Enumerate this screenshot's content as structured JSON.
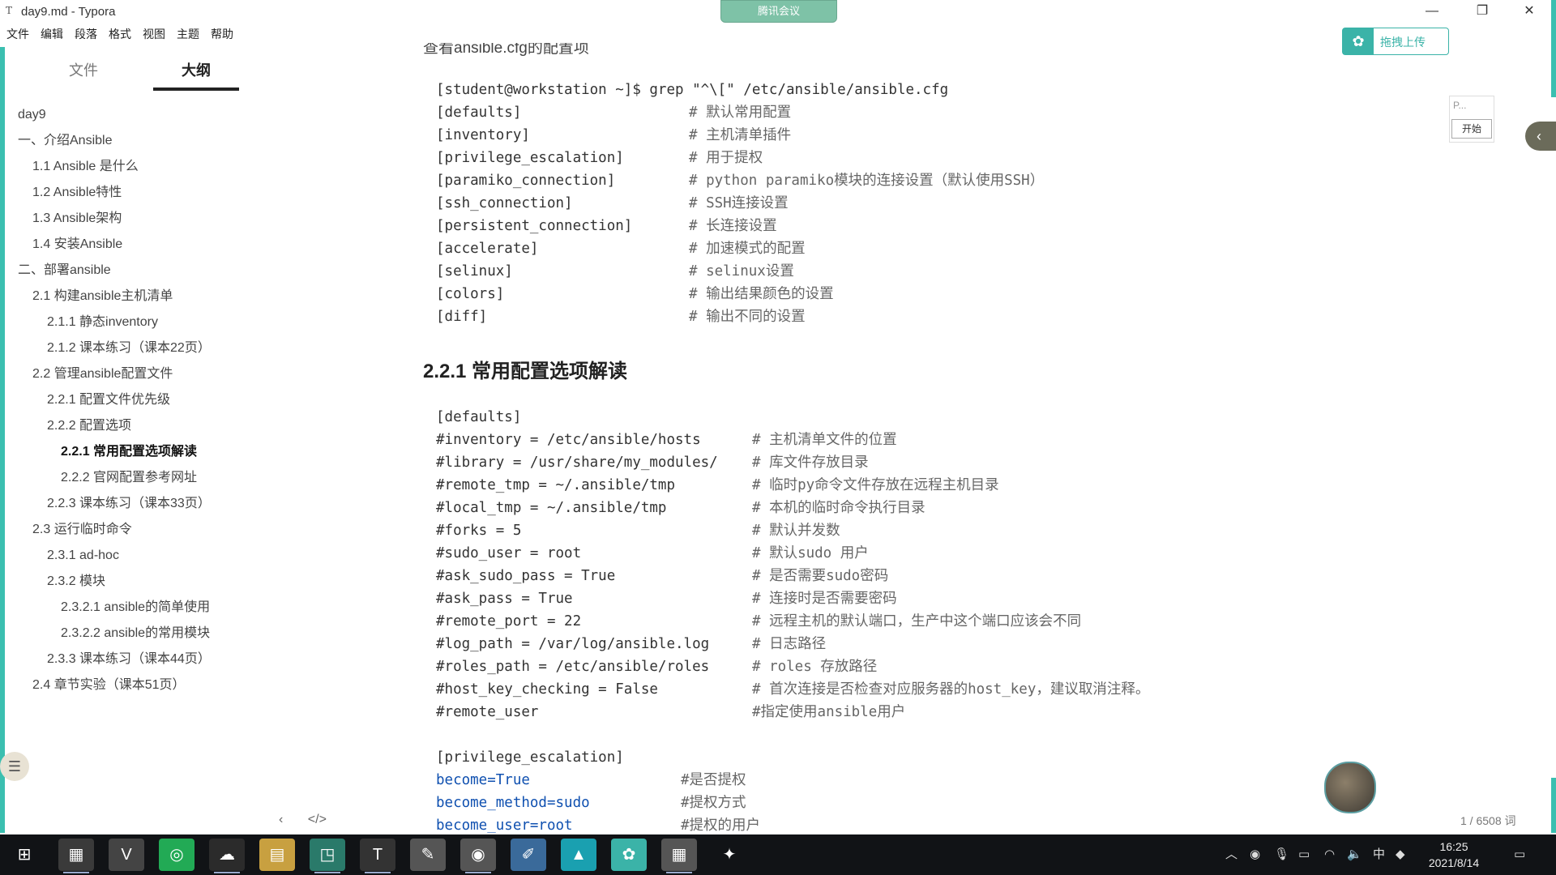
{
  "window": {
    "title": "day9.md - Typora",
    "minimize": "—",
    "maximize": "❐",
    "close": "✕"
  },
  "meeting": {
    "label": "腾讯会议"
  },
  "menu": [
    "文件",
    "编辑",
    "段落",
    "格式",
    "视图",
    "主题",
    "帮助"
  ],
  "sidebar": {
    "tabs": [
      {
        "label": "文件",
        "active": false
      },
      {
        "label": "大纲",
        "active": true
      }
    ],
    "outline": [
      {
        "label": "day9",
        "level": 0
      },
      {
        "label": "一、介绍Ansible",
        "level": 0
      },
      {
        "label": "1.1 Ansible 是什么",
        "level": 1
      },
      {
        "label": "1.2 Ansible特性",
        "level": 1
      },
      {
        "label": "1.3 Ansible架构",
        "level": 1
      },
      {
        "label": "1.4 安装Ansible",
        "level": 1
      },
      {
        "label": "二、部署ansible",
        "level": 0
      },
      {
        "label": "2.1 构建ansible主机清单",
        "level": 1
      },
      {
        "label": "2.1.1 静态inventory",
        "level": 2
      },
      {
        "label": "2.1.2 课本练习（课本22页）",
        "level": 2
      },
      {
        "label": "2.2 管理ansible配置文件",
        "level": 1
      },
      {
        "label": "2.2.1 配置文件优先级",
        "level": 2
      },
      {
        "label": "2.2.2 配置选项",
        "level": 2
      },
      {
        "label": "2.2.1 常用配置选项解读",
        "level": 3,
        "active": true
      },
      {
        "label": "2.2.2 官网配置参考网址",
        "level": 3
      },
      {
        "label": "2.2.3 课本练习（课本33页）",
        "level": 2
      },
      {
        "label": "2.3 运行临时命令",
        "level": 1
      },
      {
        "label": "2.3.1 ad-hoc",
        "level": 2
      },
      {
        "label": "2.3.2 模块",
        "level": 2
      },
      {
        "label": "2.3.2.1 ansible的简单使用",
        "level": 3
      },
      {
        "label": "2.3.2.2 ansible的常用模块",
        "level": 3
      },
      {
        "label": "2.3.3 课本练习（课本44页）",
        "level": 2
      },
      {
        "label": "2.4 章节实验（课本51页）",
        "level": 1
      }
    ],
    "bottom": {
      "back": "‹",
      "source": "</>"
    }
  },
  "editor": {
    "cut_heading": "查看ansible.cfg的配置项",
    "block1": [
      {
        "a": "[student@workstation ~]$ grep \"^\\[\" /etc/ansible/ansible.cfg",
        "b": ""
      },
      {
        "a": "[defaults]",
        "b": "# 默认常用配置"
      },
      {
        "a": "[inventory]",
        "b": "# 主机清单插件"
      },
      {
        "a": "[privilege_escalation]",
        "b": "# 用于提权"
      },
      {
        "a": "[paramiko_connection]",
        "b": "# python paramiko模块的连接设置（默认使用SSH）"
      },
      {
        "a": "[ssh_connection]",
        "b": "# SSH连接设置"
      },
      {
        "a": "[persistent_connection]",
        "b": "# 长连接设置"
      },
      {
        "a": "[accelerate]",
        "b": "# 加速模式的配置"
      },
      {
        "a": "[selinux]",
        "b": "# selinux设置"
      },
      {
        "a": "[colors]",
        "b": "# 输出结果颜色的设置"
      },
      {
        "a": "[diff]",
        "b": "# 输出不同的设置"
      }
    ],
    "heading": "2.2.1 常用配置选项解读",
    "block2": [
      {
        "a": "[defaults]",
        "b": ""
      },
      {
        "a": "#inventory = /etc/ansible/hosts",
        "b": "# 主机清单文件的位置"
      },
      {
        "a": "#library = /usr/share/my_modules/",
        "b": "# 库文件存放目录"
      },
      {
        "a": "#remote_tmp = ~/.ansible/tmp",
        "b": "# 临时py命令文件存放在远程主机目录"
      },
      {
        "a": "#local_tmp = ~/.ansible/tmp",
        "b": "# 本机的临时命令执行目录"
      },
      {
        "a": "#forks = 5",
        "b": "# 默认并发数"
      },
      {
        "a": "#sudo_user = root",
        "b": "# 默认sudo 用户"
      },
      {
        "a": "#ask_sudo_pass = True",
        "b": "# 是否需要sudo密码"
      },
      {
        "a": "#ask_pass = True",
        "b": "# 连接时是否需要密码"
      },
      {
        "a": "#remote_port = 22",
        "b": "# 远程主机的默认端口，生产中这个端口应该会不同"
      },
      {
        "a": "#log_path = /var/log/ansible.log",
        "b": "# 日志路径"
      },
      {
        "a": "#roles_path = /etc/ansible/roles",
        "b": "# roles 存放路径"
      },
      {
        "a": "#host_key_checking = False",
        "b": "# 首次连接是否检查对应服务器的host_key，建议取消注释。"
      },
      {
        "a": "#remote_user",
        "b": "#指定使用ansible用户"
      },
      {
        "a": "",
        "b": ""
      },
      {
        "a": "[privilege_escalation]",
        "b": ""
      },
      {
        "a": "become=True",
        "b": "#是否提权"
      },
      {
        "a": "become_method=sudo",
        "b": "#提权方式"
      },
      {
        "a": "become_user=root",
        "b": "#提权的用户"
      }
    ]
  },
  "widgets": {
    "upload_label": "拖拽上传",
    "mini_title": "P...",
    "mini_button": "开始",
    "wordcount": "1 / 6508 词"
  },
  "taskbar": {
    "apps": [
      {
        "name": "start-icon",
        "glyph": "⊞",
        "bg": "transparent"
      },
      {
        "name": "photo-app-icon",
        "glyph": "▦",
        "bg": "#3a3a3a",
        "open": true
      },
      {
        "name": "vivaldi-icon",
        "glyph": "V",
        "bg": "#444"
      },
      {
        "name": "browser-icon",
        "glyph": "◎",
        "bg": "#2a5"
      },
      {
        "name": "wechat-icon",
        "glyph": "☁",
        "bg": "#2b2b2b",
        "open": true
      },
      {
        "name": "file-explorer-icon",
        "glyph": "▤",
        "bg": "#c8a040"
      },
      {
        "name": "virtualbox-icon",
        "glyph": "◳",
        "bg": "#2a7a6a",
        "open": true
      },
      {
        "name": "typora-icon",
        "glyph": "T",
        "bg": "#333",
        "open": true
      },
      {
        "name": "game-icon",
        "glyph": "✎",
        "bg": "#555"
      },
      {
        "name": "recorder-icon",
        "glyph": "◉",
        "bg": "#555",
        "open": true
      },
      {
        "name": "notes-icon",
        "glyph": "✐",
        "bg": "#3a6a9a"
      },
      {
        "name": "maps-app-icon",
        "glyph": "▲",
        "bg": "#1aa0b0"
      },
      {
        "name": "upload-app-icon",
        "glyph": "✿",
        "bg": "#3bb3a8"
      },
      {
        "name": "image-app-icon",
        "glyph": "▦",
        "bg": "#555",
        "open": true
      },
      {
        "name": "misc-icon",
        "glyph": "✦",
        "bg": "transparent"
      }
    ],
    "tray": {
      "chevron": "︿",
      "ime": "中",
      "time": "16:25",
      "date": "2021/8/14"
    }
  }
}
